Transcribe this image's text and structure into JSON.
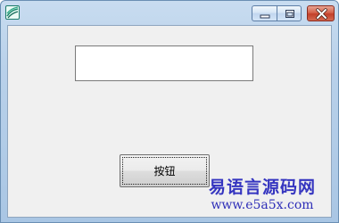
{
  "window": {
    "icon": "app-icon",
    "controls": {
      "minimize_icon": "minimize-icon",
      "maximize_icon": "maximize-icon",
      "close_icon": "close-icon"
    }
  },
  "form": {
    "text_input": {
      "value": "",
      "placeholder": ""
    },
    "button": {
      "label": "按钮"
    }
  },
  "watermark": {
    "title": "易语言源码网",
    "url": "www.e5a5x.com"
  },
  "colors": {
    "title_bar": "#b9d1ea",
    "client_background": "#f0f0f0",
    "close_button": "#c2402a",
    "watermark_text": "#3535c0"
  }
}
